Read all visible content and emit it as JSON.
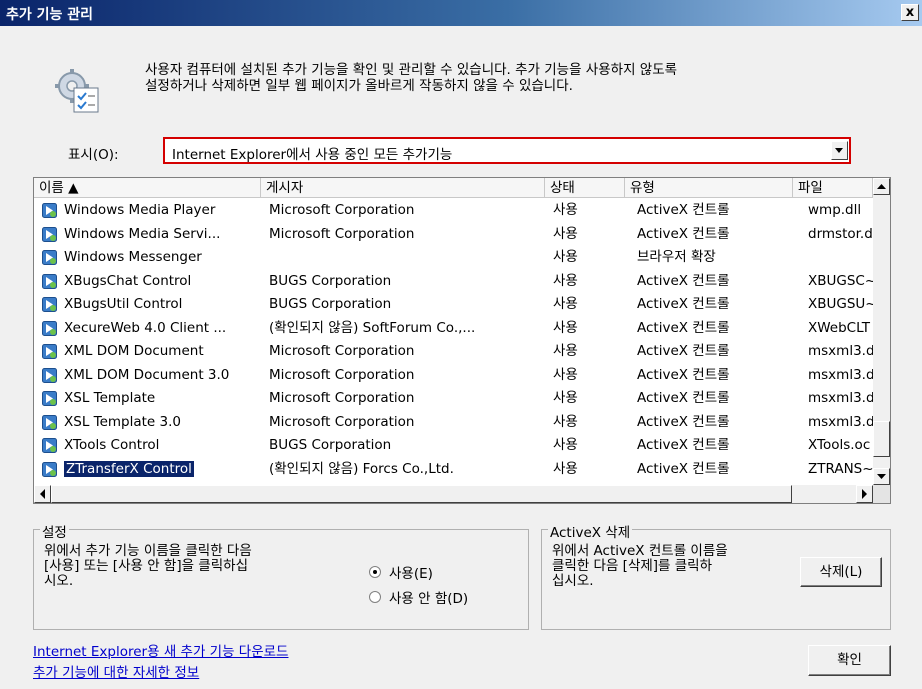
{
  "window": {
    "title": "추가 기능 관리",
    "close_glyph": "x"
  },
  "description": {
    "line1": "사용자 컴퓨터에 설치된 추가 기능을 확인 및 관리할 수 있습니다. 추가 기능을 사용하지 않도록",
    "line2": "설정하거나 삭제하면 일부 웹 페이지가 올바르게 작동하지 않을 수 있습니다."
  },
  "show": {
    "label": "표시(O):",
    "selected": "Internet Explorer에서 사용 중인 모든 추가기능"
  },
  "table": {
    "columns": [
      "이름 ▲",
      "게시자",
      "상태",
      "유형",
      "파일"
    ],
    "rows": [
      [
        "Windows Media Player",
        "Microsoft Corporation",
        "사용",
        "ActiveX 컨트롤",
        "wmp.dll"
      ],
      [
        "Windows Media Servi...",
        "Microsoft Corporation",
        "사용",
        "ActiveX 컨트롤",
        "drmstor.dl"
      ],
      [
        "Windows Messenger",
        "",
        "사용",
        "브라우저 확장",
        ""
      ],
      [
        "XBugsChat Control",
        "BUGS Corporation",
        "사용",
        "ActiveX 컨트롤",
        "XBUGSC~"
      ],
      [
        "XBugsUtil Control",
        "BUGS Corporation",
        "사용",
        "ActiveX 컨트롤",
        "XBUGSU~"
      ],
      [
        "XecureWeb 4.0 Client ...",
        "(확인되지 않음) SoftForum Co.,...",
        "사용",
        "ActiveX 컨트롤",
        "XWebCLT"
      ],
      [
        "XML DOM Document",
        "Microsoft Corporation",
        "사용",
        "ActiveX 컨트롤",
        "msxml3.d"
      ],
      [
        "XML DOM Document 3.0",
        "Microsoft Corporation",
        "사용",
        "ActiveX 컨트롤",
        "msxml3.d"
      ],
      [
        "XSL Template",
        "Microsoft Corporation",
        "사용",
        "ActiveX 컨트롤",
        "msxml3.d"
      ],
      [
        "XSL Template 3.0",
        "Microsoft Corporation",
        "사용",
        "ActiveX 컨트롤",
        "msxml3.d"
      ],
      [
        "XTools Control",
        "BUGS Corporation",
        "사용",
        "ActiveX 컨트롤",
        "XTools.oc"
      ],
      [
        "ZTransferX Control",
        "(확인되지 않음) Forcs Co.,Ltd.",
        "사용",
        "ActiveX 컨트롤",
        "ZTRANS~"
      ]
    ],
    "selected_index": 11
  },
  "settings": {
    "title": "설정",
    "text1": "위에서 추가 기능 이름을 클릭한 다음",
    "text2": "[사용] 또는 [사용 안 함]을 클릭하십",
    "text3": "시오.",
    "radio_enable": "사용(E)",
    "radio_disable": "사용 안 함(D)"
  },
  "activex": {
    "title": "ActiveX 삭제",
    "text1": "위에서 ActiveX 컨트롤 이름을",
    "text2": "클릭한 다음 [삭제]를 클릭하",
    "text3": "십시오.",
    "delete_label": "삭제(L)"
  },
  "links": {
    "download": "Internet Explorer용 새 추가 기능 다운로드",
    "info": "추가 기능에 대한 자세한 정보"
  },
  "ok_label": "확인",
  "colors": {
    "selection": "#0a246a",
    "highlight_border": "#d40000",
    "link": "#0000cc"
  }
}
